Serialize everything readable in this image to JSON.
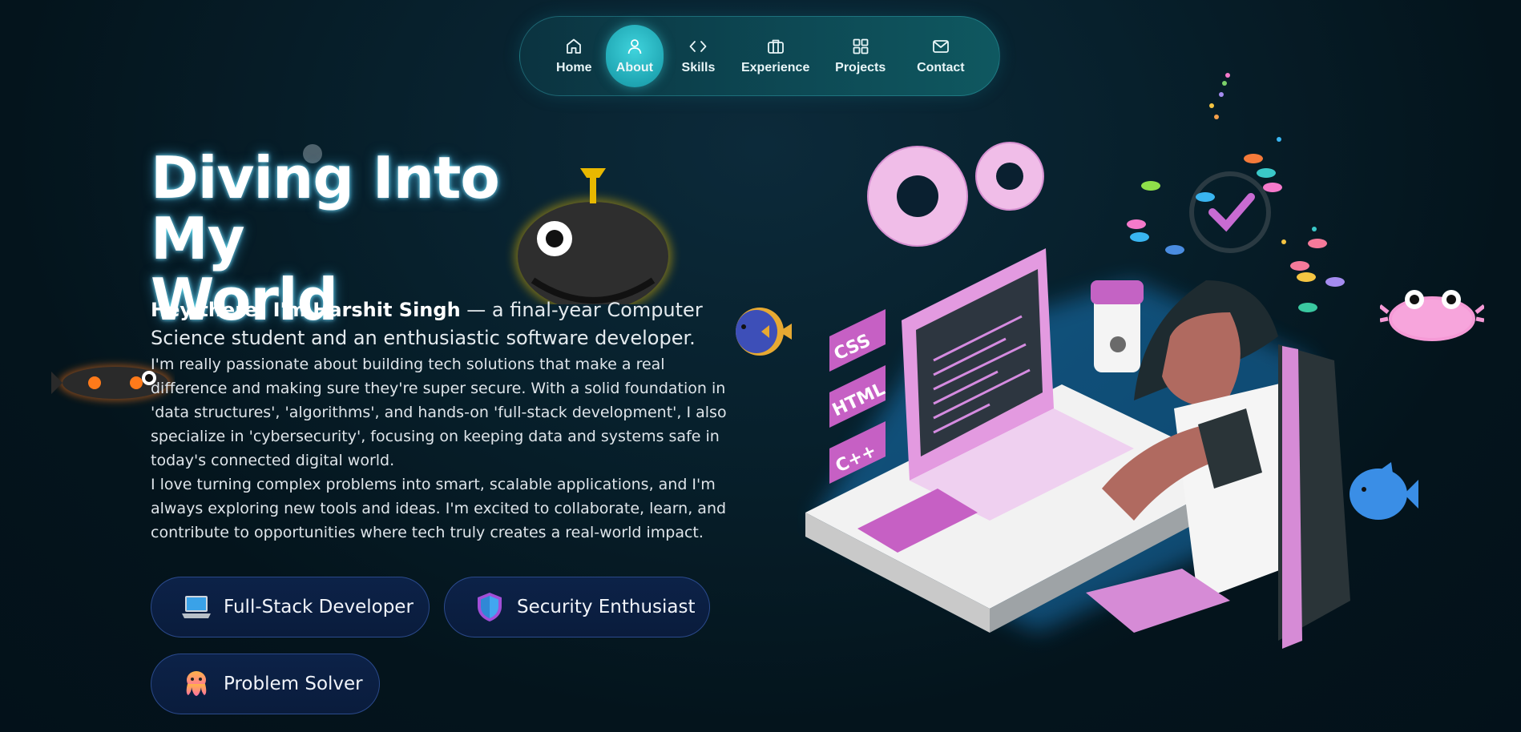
{
  "nav": {
    "items": [
      {
        "label": "Home",
        "icon": "home-icon"
      },
      {
        "label": "About",
        "icon": "user-icon",
        "active": true
      },
      {
        "label": "Skills",
        "icon": "code-icon"
      },
      {
        "label": "Experience",
        "icon": "briefcase-icon"
      },
      {
        "label": "Projects",
        "icon": "grid-icon"
      },
      {
        "label": "Contact",
        "icon": "mail-icon"
      }
    ]
  },
  "hero": {
    "title_line1": "Diving Into My",
    "title_line2": "World",
    "intro_name": "Hey there! I'm Harshit Singh",
    "intro_rest": " — a final-year Computer Science student and an enthusiastic software developer.",
    "paragraph1": "I'm really passionate about building tech solutions that make a real difference and making sure they're super secure. With a solid foundation in 'data structures', 'algorithms', and hands-on 'full-stack development', I also specialize in 'cybersecurity', focusing on keeping data and systems safe in today's connected digital world.",
    "paragraph2": "I love turning complex problems into smart, scalable applications, and I'm always exploring new tools and ideas. I'm excited to collaborate, learn, and contribute to opportunities where tech truly creates a real-world impact."
  },
  "pills": [
    {
      "label": "Full-Stack Developer",
      "icon": "laptop-icon"
    },
    {
      "label": "Security Enthusiast",
      "icon": "shield-icon"
    },
    {
      "label": "Problem Solver",
      "icon": "octopus-icon"
    }
  ],
  "illustration": {
    "screen_labels": [
      "CSS",
      "HTML",
      "C++"
    ]
  },
  "colors": {
    "background": "#04141c",
    "nav_active": "#2bbcc6",
    "accent_pink": "#e58ad8",
    "glow_cyan": "#3fd3dc",
    "pill_bg": "#0b1f42"
  }
}
